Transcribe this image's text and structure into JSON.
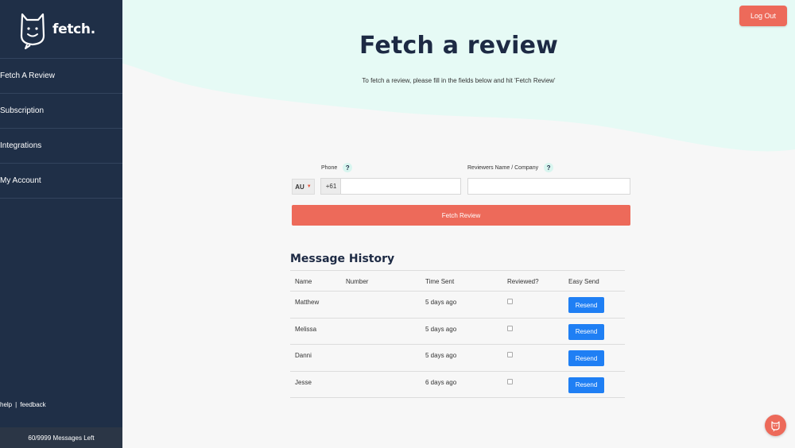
{
  "brand": {
    "name": "fetch."
  },
  "sidebar": {
    "items": [
      {
        "label": "Fetch A Review"
      },
      {
        "label": "Subscription"
      },
      {
        "label": "Integrations"
      },
      {
        "label": "My Account"
      }
    ],
    "footer": {
      "help": "help",
      "separator": "|",
      "feedback": "feedback"
    },
    "messages_left": "60/9999 Messages Left"
  },
  "header": {
    "logout_label": "Log Out"
  },
  "hero": {
    "title": "Fetch a review",
    "subtitle": "To fetch a review, please fill in the fields below and hit 'Fetch Review'"
  },
  "form": {
    "country": "AU",
    "phone_label": "Phone",
    "phone_prefix": "+61",
    "phone_value": "",
    "name_label": "Reviewers Name / Company",
    "name_value": "",
    "help_glyph": "?",
    "submit_label": "Fetch Review"
  },
  "history": {
    "title": "Message History",
    "columns": [
      "Name",
      "Number",
      "Time Sent",
      "Reviewed?",
      "Easy Send"
    ],
    "rows": [
      {
        "name": "Matthew",
        "number": "",
        "time": "5 days ago",
        "reviewed": false,
        "action": "Resend"
      },
      {
        "name": "Melissa",
        "number": "",
        "time": "5 days ago",
        "reviewed": false,
        "action": "Resend"
      },
      {
        "name": "Danni",
        "number": "",
        "time": "5 days ago",
        "reviewed": false,
        "action": "Resend"
      },
      {
        "name": "Jesse",
        "number": "",
        "time": "6 days ago",
        "reviewed": false,
        "action": "Resend"
      }
    ]
  },
  "colors": {
    "sidebar": "#1f2f47",
    "accent": "#ed6a5a",
    "hero": "#e6faf5",
    "resend": "#1f7ff4",
    "heading": "#1d2a44"
  },
  "icons": {
    "logo": "dog-face-icon",
    "country_caret": "caret-down-icon",
    "chat": "chat-bubble-icon"
  }
}
